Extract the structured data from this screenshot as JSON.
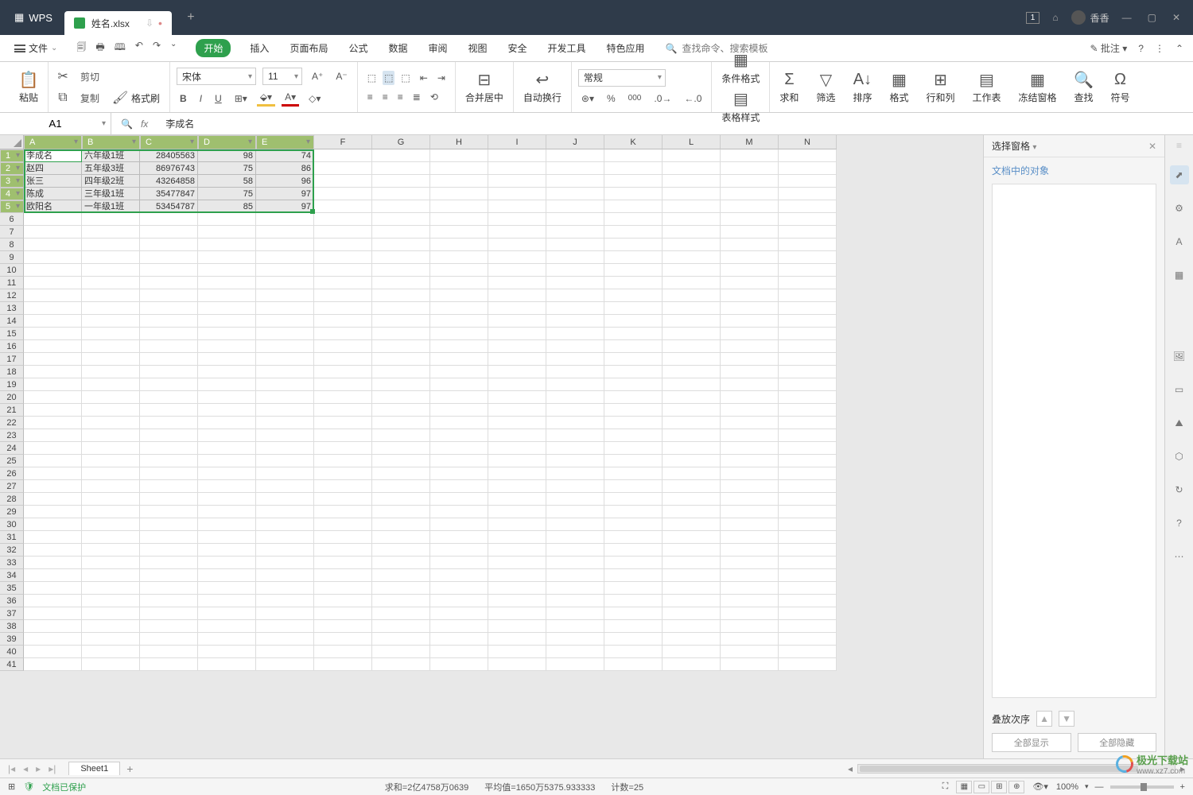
{
  "titlebar": {
    "app": "WPS",
    "tab_name": "姓名.xlsx",
    "user": "香香"
  },
  "menubar": {
    "file": "文件",
    "tabs": [
      "开始",
      "插入",
      "页面布局",
      "公式",
      "数据",
      "审阅",
      "视图",
      "安全",
      "开发工具",
      "特色应用"
    ],
    "active_tab": 0,
    "search_placeholder": "查找命令、搜索模板",
    "annotate": "批注"
  },
  "ribbon": {
    "paste": "粘贴",
    "cut": "剪切",
    "copy": "复制",
    "format_painter": "格式刷",
    "font": "宋体",
    "font_size": "11",
    "merge": "合并居中",
    "wrap": "自动换行",
    "number_format": "常规",
    "cond_format": "条件格式",
    "table_style": "表格样式",
    "sum": "求和",
    "filter": "筛选",
    "sort": "排序",
    "format": "格式",
    "rowcol": "行和列",
    "sheet": "工作表",
    "freeze": "冻结窗格",
    "find": "查找",
    "symbol": "符号"
  },
  "formula_bar": {
    "cell_ref": "A1",
    "value": "李成名"
  },
  "columns": [
    "A",
    "B",
    "C",
    "D",
    "E",
    "F",
    "G",
    "H",
    "I",
    "J",
    "K",
    "L",
    "M",
    "N"
  ],
  "row_count": 41,
  "data": [
    [
      "李成名",
      "六年级1班",
      "28405563",
      "98",
      "74"
    ],
    [
      "赵四",
      "五年级3班",
      "86976743",
      "75",
      "86"
    ],
    [
      "张三",
      "四年级2班",
      "43264858",
      "58",
      "96"
    ],
    [
      "陈成",
      "三年级1班",
      "35477847",
      "75",
      "97"
    ],
    [
      "欧阳名",
      "一年级1班",
      "53454787",
      "85",
      "97"
    ]
  ],
  "side_panel": {
    "title": "选择窗格",
    "subtitle": "文档中的对象",
    "order": "叠放次序",
    "show_all": "全部显示",
    "hide_all": "全部隐藏"
  },
  "sheet_tabs": {
    "active": "Sheet1"
  },
  "statusbar": {
    "protect": "文档已保护",
    "sum": "求和=2亿4758万0639",
    "avg": "平均值=1650万5375.933333",
    "count": "计数=25",
    "zoom": "100%"
  },
  "watermark": {
    "brand": "极光下载站",
    "url": "www.xz7.com"
  }
}
